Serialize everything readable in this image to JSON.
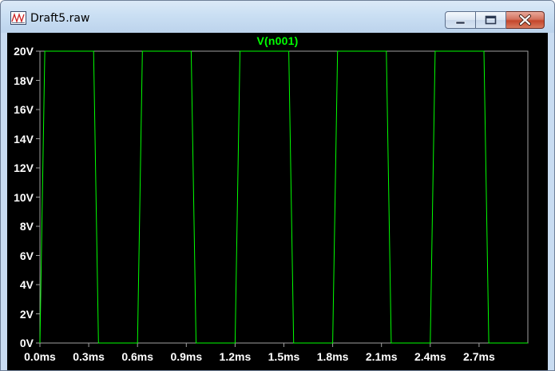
{
  "window": {
    "title": "Draft5.raw",
    "icon": "waveform-app-icon",
    "buttons": {
      "minimize": "minimize-icon",
      "maximize": "maximize-icon",
      "close": "close-icon"
    }
  },
  "colors": {
    "plot_background": "#000000",
    "trace": "#00ff00",
    "axis": "#a0a0a0",
    "tick_labels": "#ffffff",
    "title_bar": "#c9dcf1",
    "close_button": "#c4462b"
  },
  "chart_data": {
    "type": "line",
    "title": "V(n001)",
    "xlabel": "",
    "ylabel": "",
    "x_unit": "ms",
    "y_unit": "V",
    "xlim": [
      0.0,
      3.0
    ],
    "ylim": [
      0,
      20
    ],
    "grid": false,
    "x_tick_values": [
      0.0,
      0.3,
      0.6,
      0.9,
      1.2,
      1.5,
      1.8,
      2.1,
      2.4,
      2.7
    ],
    "x_tick_labels": [
      "0.0ms",
      "0.3ms",
      "0.6ms",
      "0.9ms",
      "1.2ms",
      "1.5ms",
      "1.8ms",
      "2.1ms",
      "2.4ms",
      "2.7ms"
    ],
    "y_tick_values": [
      0,
      2,
      4,
      6,
      8,
      10,
      12,
      14,
      16,
      18,
      20
    ],
    "y_tick_labels": [
      "0V",
      "2V",
      "4V",
      "6V",
      "8V",
      "10V",
      "12V",
      "14V",
      "16V",
      "18V",
      "20V"
    ],
    "series": [
      {
        "name": "V(n001)",
        "x": [
          0.0,
          0.03,
          0.33,
          0.36,
          0.6,
          0.63,
          0.93,
          0.96,
          1.2,
          1.23,
          1.53,
          1.56,
          1.8,
          1.83,
          2.13,
          2.16,
          2.4,
          2.43,
          2.73,
          2.76,
          3.0
        ],
        "y": [
          0,
          20,
          20,
          0,
          0,
          20,
          20,
          0,
          0,
          20,
          20,
          0,
          0,
          20,
          20,
          0,
          0,
          20,
          20,
          0,
          0
        ]
      }
    ]
  }
}
